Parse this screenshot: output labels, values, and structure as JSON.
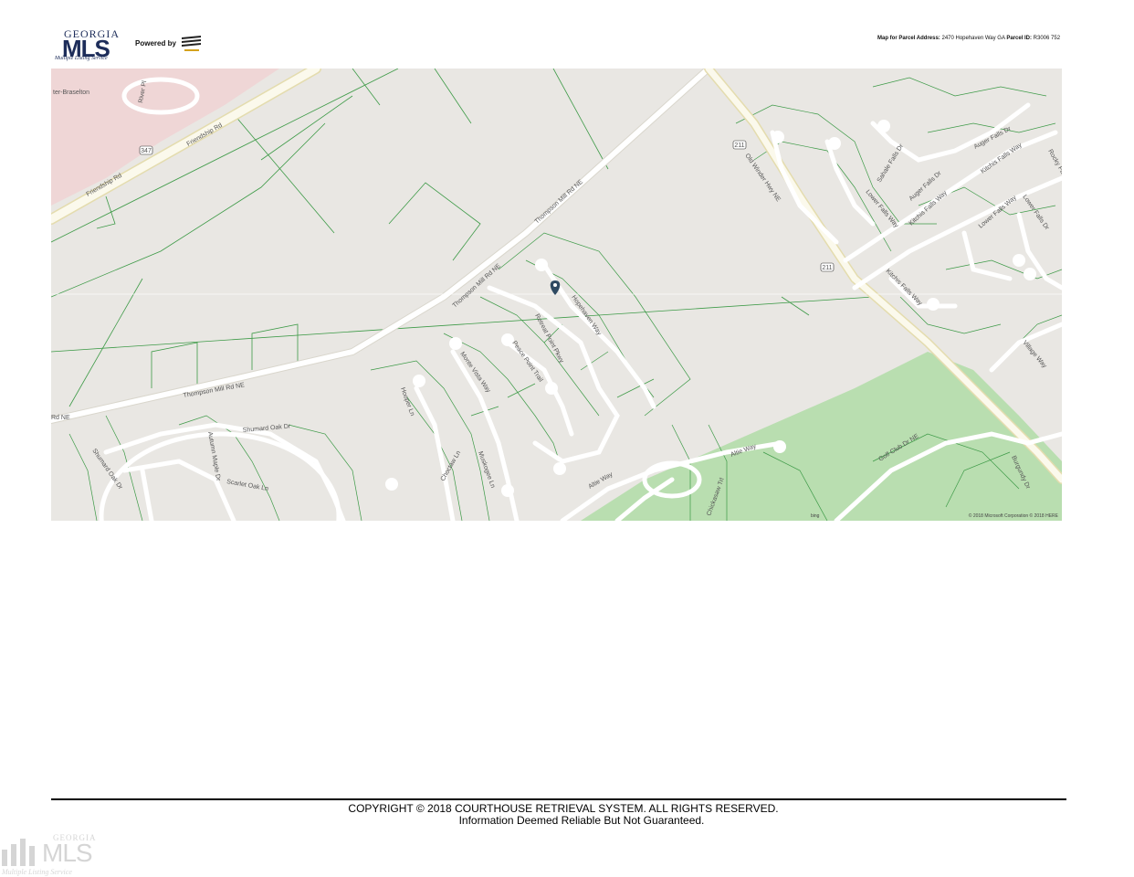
{
  "header": {
    "logo_top": "GEORGIA",
    "logo_main": "MLS",
    "logo_tagline": "Multiple Listing Service",
    "powered_by": "Powered by",
    "address_label": "Map for Parcel Address:",
    "address_value": "2470 Hopehaven Way GA",
    "parcel_label": "Parcel ID:",
    "parcel_value": "R3006 752"
  },
  "map": {
    "labels": {
      "braselton": "ter-Braselton",
      "river_pl": "River Pl",
      "friendship_rd_1": "Friendship Rd",
      "friendship_rd_2": "Friendship Rd",
      "shield_347": "347",
      "thompson_mill_1": "Thompson Mill Rd NE",
      "thompson_mill_2": "Thompson Mill Rd NE",
      "thompson_mill_3": "Thompson Mill Rd NE",
      "rd_ne": "Rd NE",
      "old_winder": "Old Winder Hwy NE",
      "shield_211a": "211",
      "shield_211b": "211",
      "hopehaven": "Hopehaven Way",
      "retreat_point": "Retreat Point Pkwy",
      "peace_point": "Peace Point Trail",
      "monte_vista": "Monte Vista Way",
      "shumard_oak_1": "Shumard Oak Dr",
      "shumard_oak_2": "Shumard Oak Dr",
      "autumn_maple": "Autumn Maple Dr",
      "scarlet_oak": "Scarlet Oak Ln",
      "hoopers": "Hooper Ln",
      "choctaw_ln": "Choctaw Ln",
      "muskogee": "Muskogee Ln",
      "altie_way": "Altie Way",
      "altie_way_2": "Altie Way",
      "chickasaw": "Chickasaw Trl",
      "golf_club": "Golf Club Dr NE",
      "burgundy": "Burgundy Dr",
      "village_way": "Village Way",
      "sahale_falls": "Sahale Falls Dr",
      "auger_falls_1": "Auger Falls Dr",
      "auger_falls_2": "Auger Falls Dr",
      "lower_falls": "Lower Falls Way",
      "kitchis_1": "Kitchis Falls Way",
      "kitchis_2": "Kitchis Falls Way",
      "kitchis_3": "Kitchis Falls Way",
      "lower_falls_2": "Lower Falls Way",
      "lower_falls_3": "Lower Falls Dr",
      "rocky_falls": "Rocky Falls Way"
    },
    "credit": "© 2018 Microsoft Corporation © 2018 HERE",
    "bing": "bing"
  },
  "footer": {
    "copyright": "COPYRIGHT © 2018 COURTHOUSE RETRIEVAL SYSTEM. ALL RIGHTS RESERVED.",
    "disclaimer": "Information Deemed Reliable But Not Guaranteed."
  },
  "watermark": {
    "top": "GEORGIA",
    "main": "MLS",
    "tagline": "Multiple Listing Service"
  },
  "colors": {
    "parcel_line": "#3d9a47",
    "road": "#fbf9ec",
    "road_edge": "#e4dcae",
    "golf_green": "#b9deb0",
    "commercial_pink": "#efd6d6",
    "background": "#e9e7e3",
    "pin": "#2f4a62"
  }
}
